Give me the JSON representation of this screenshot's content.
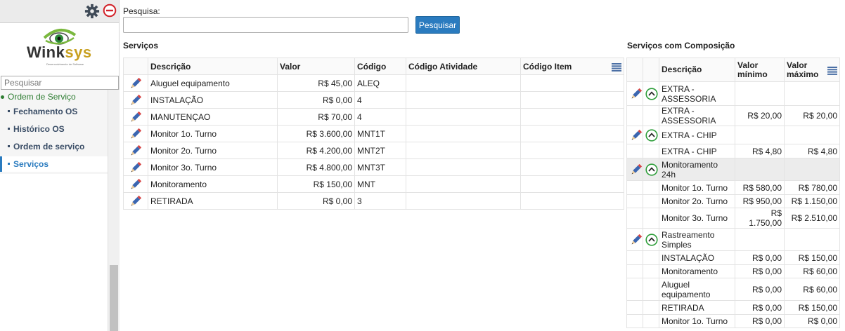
{
  "sidebar": {
    "logo_text_a": "Wink",
    "logo_text_b": "sys",
    "logo_tagline": "Desenvolvimento de Software",
    "search_placeholder": "Pesquisar",
    "menu_root": "Ordem de Serviço",
    "items": [
      {
        "label": "Fechamento OS"
      },
      {
        "label": "Histórico OS"
      },
      {
        "label": "Ordem de serviço"
      },
      {
        "label": "Serviços"
      }
    ],
    "icons": [
      "gear-icon",
      "close-circle-icon"
    ]
  },
  "search": {
    "label": "Pesquisa:",
    "value": "",
    "button_label": "Pesquisar"
  },
  "servicos": {
    "title": "Serviços",
    "columns": [
      "Descrição",
      "Valor",
      "Código",
      "Código Atividade",
      "Código Item"
    ],
    "rows": [
      {
        "descricao": "Aluguel equipamento",
        "valor": "R$ 45,00",
        "codigo": "ALEQ",
        "atividade": "",
        "item": ""
      },
      {
        "descricao": "INSTALAÇÃO",
        "valor": "R$ 0,00",
        "codigo": "4",
        "atividade": "",
        "item": ""
      },
      {
        "descricao": "MANUTENÇAO",
        "valor": "R$ 70,00",
        "codigo": "4",
        "atividade": "",
        "item": ""
      },
      {
        "descricao": "Monitor 1o. Turno",
        "valor": "R$ 3.600,00",
        "codigo": "MNT1T",
        "atividade": "",
        "item": ""
      },
      {
        "descricao": "Monitor 2o. Turno",
        "valor": "R$ 4.200,00",
        "codigo": "MNT2T",
        "atividade": "",
        "item": ""
      },
      {
        "descricao": "Monitor 3o. Turno",
        "valor": "R$ 4.800,00",
        "codigo": "MNT3T",
        "atividade": "",
        "item": ""
      },
      {
        "descricao": "Monitoramento",
        "valor": "R$ 150,00",
        "codigo": "MNT",
        "atividade": "",
        "item": ""
      },
      {
        "descricao": "RETIRADA",
        "valor": "R$ 0,00",
        "codigo": "3",
        "atividade": "",
        "item": ""
      }
    ]
  },
  "composicao": {
    "title": "Serviços com Composição",
    "columns": [
      "Descrição",
      "Valor mínimo",
      "Valor máximo"
    ],
    "rows": [
      {
        "type": "group",
        "descricao": "EXTRA - ASSESSORIA",
        "min": "",
        "max": ""
      },
      {
        "type": "child",
        "descricao": "EXTRA - ASSESSORIA",
        "min": "R$ 20,00",
        "max": "R$ 20,00"
      },
      {
        "type": "group",
        "descricao": "EXTRA - CHIP",
        "min": "",
        "max": ""
      },
      {
        "type": "child",
        "descricao": "EXTRA - CHIP",
        "min": "R$ 4,80",
        "max": "R$ 4,80"
      },
      {
        "type": "group",
        "descricao": "Monitoramento 24h",
        "min": "",
        "max": "",
        "highlight": true
      },
      {
        "type": "child",
        "descricao": "Monitor 1o. Turno",
        "min": "R$ 580,00",
        "max": "R$ 780,00"
      },
      {
        "type": "child",
        "descricao": "Monitor 2o. Turno",
        "min": "R$ 950,00",
        "max": "R$ 1.150,00"
      },
      {
        "type": "child",
        "descricao": "Monitor 3o. Turno",
        "min": "R$ 1.750,00",
        "max": "R$ 2.510,00"
      },
      {
        "type": "group",
        "descricao": "Rastreamento Simples",
        "min": "",
        "max": ""
      },
      {
        "type": "child",
        "descricao": "INSTALAÇÃO",
        "min": "R$ 0,00",
        "max": "R$ 150,00"
      },
      {
        "type": "child",
        "descricao": "Monitoramento",
        "min": "R$ 0,00",
        "max": "R$ 60,00"
      },
      {
        "type": "child",
        "descricao": "Aluguel equipamento",
        "min": "R$ 0,00",
        "max": "R$ 60,00"
      },
      {
        "type": "child",
        "descricao": "RETIRADA",
        "min": "R$ 0,00",
        "max": "R$ 150,00"
      },
      {
        "type": "child",
        "descricao": "Monitor 1o. Turno",
        "min": "R$ 0,00",
        "max": "R$ 0,00"
      }
    ]
  },
  "colors": {
    "accent": "#2a7bbf",
    "menu_root": "#2e7d32",
    "menu_item": "#3a4d66",
    "expand_icon": "#2e9e3a",
    "edit_icon": "#3b66b0"
  }
}
